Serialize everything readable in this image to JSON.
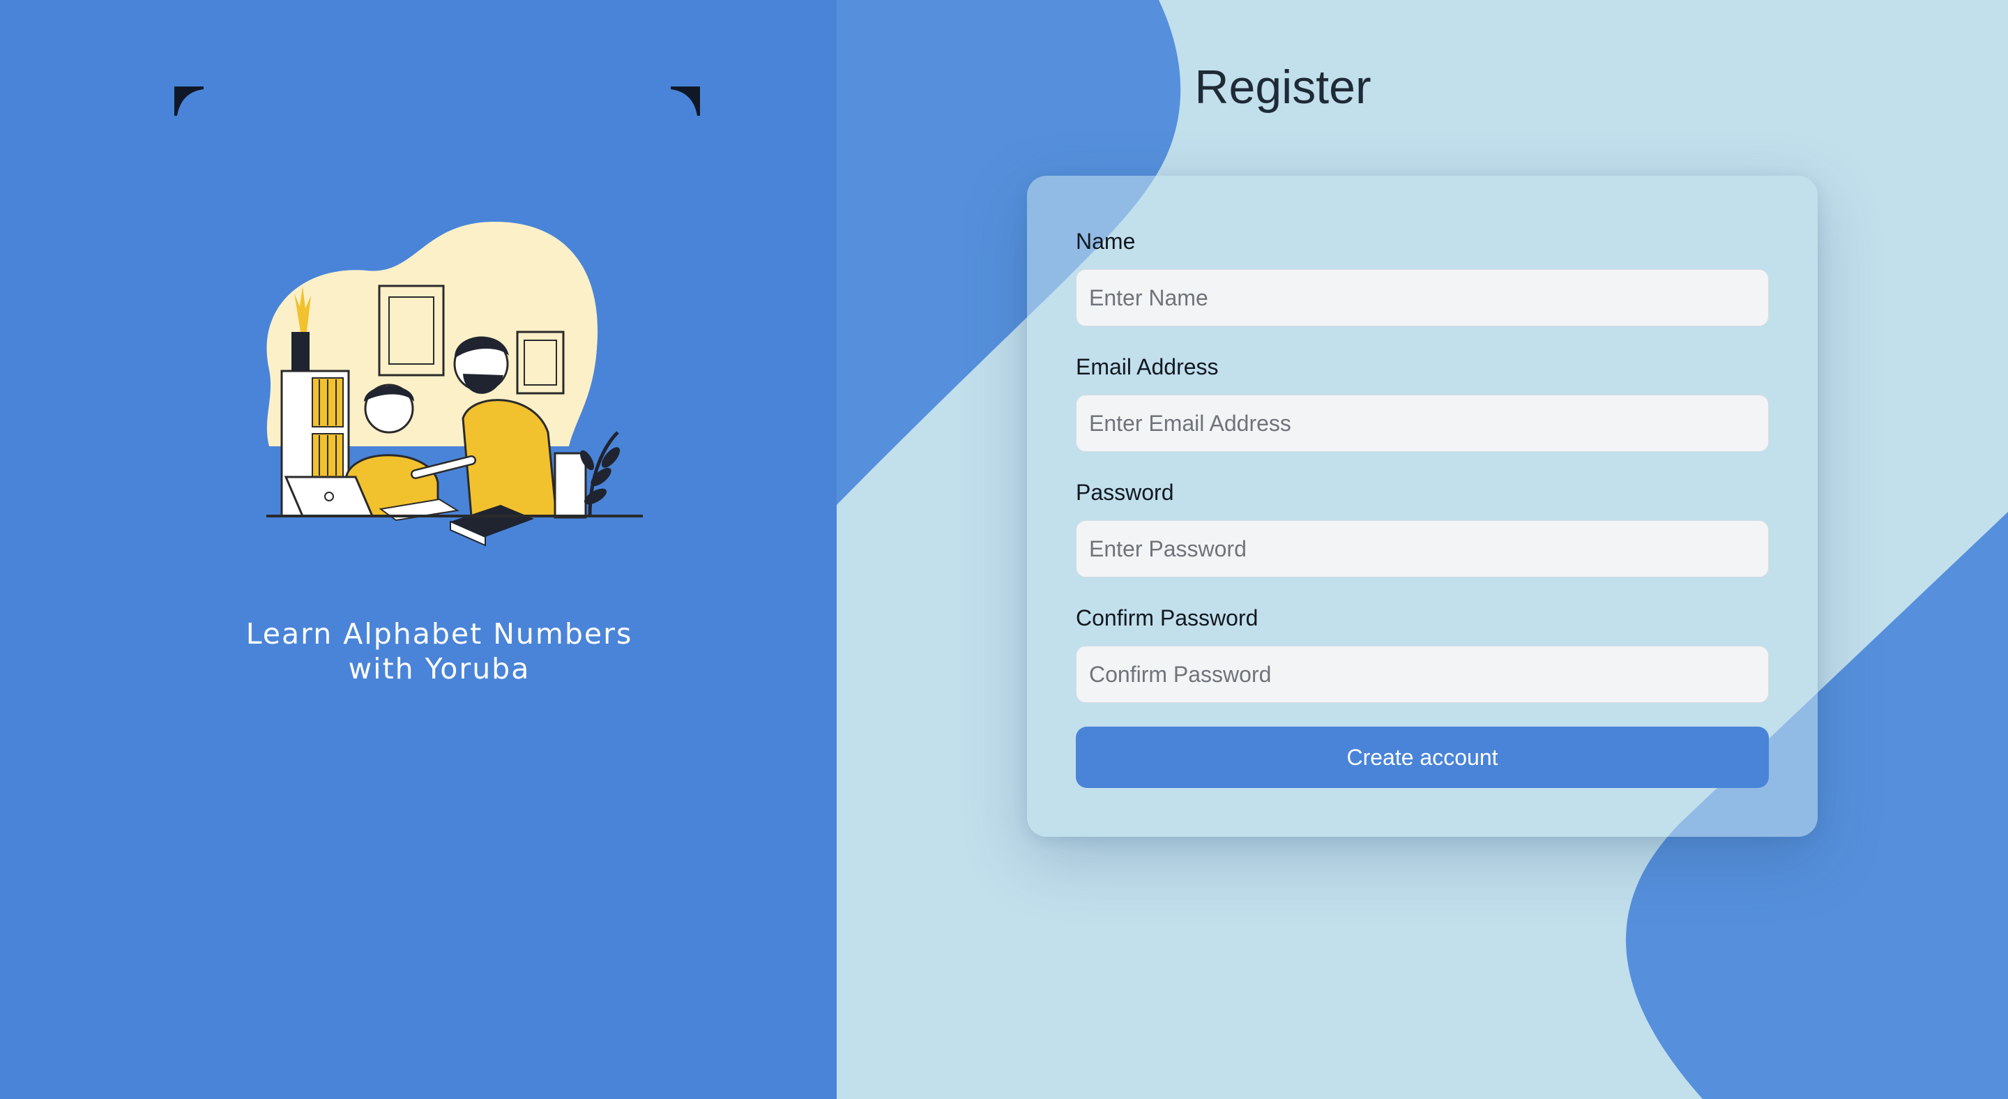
{
  "left_panel": {
    "tagline_line1": "Learn Alphabet Numbers",
    "tagline_line2": "with Yoruba",
    "illustration": "teacher-and-child-at-desk-illustration",
    "background_color": "#4a84d8"
  },
  "register": {
    "title": "Register",
    "fields": [
      {
        "label": "Name",
        "placeholder": "Enter Name",
        "value": ""
      },
      {
        "label": "Email Address",
        "placeholder": "Enter Email Address",
        "value": ""
      },
      {
        "label": "Password",
        "placeholder": "Enter Password",
        "value": ""
      },
      {
        "label": "Confirm Password",
        "placeholder": "Confirm Password",
        "value": ""
      }
    ],
    "submit_label": "Create account"
  },
  "colors": {
    "accent": "#4a84d8",
    "right_background": "#c2dfec",
    "input_background": "#f3f4f6"
  }
}
